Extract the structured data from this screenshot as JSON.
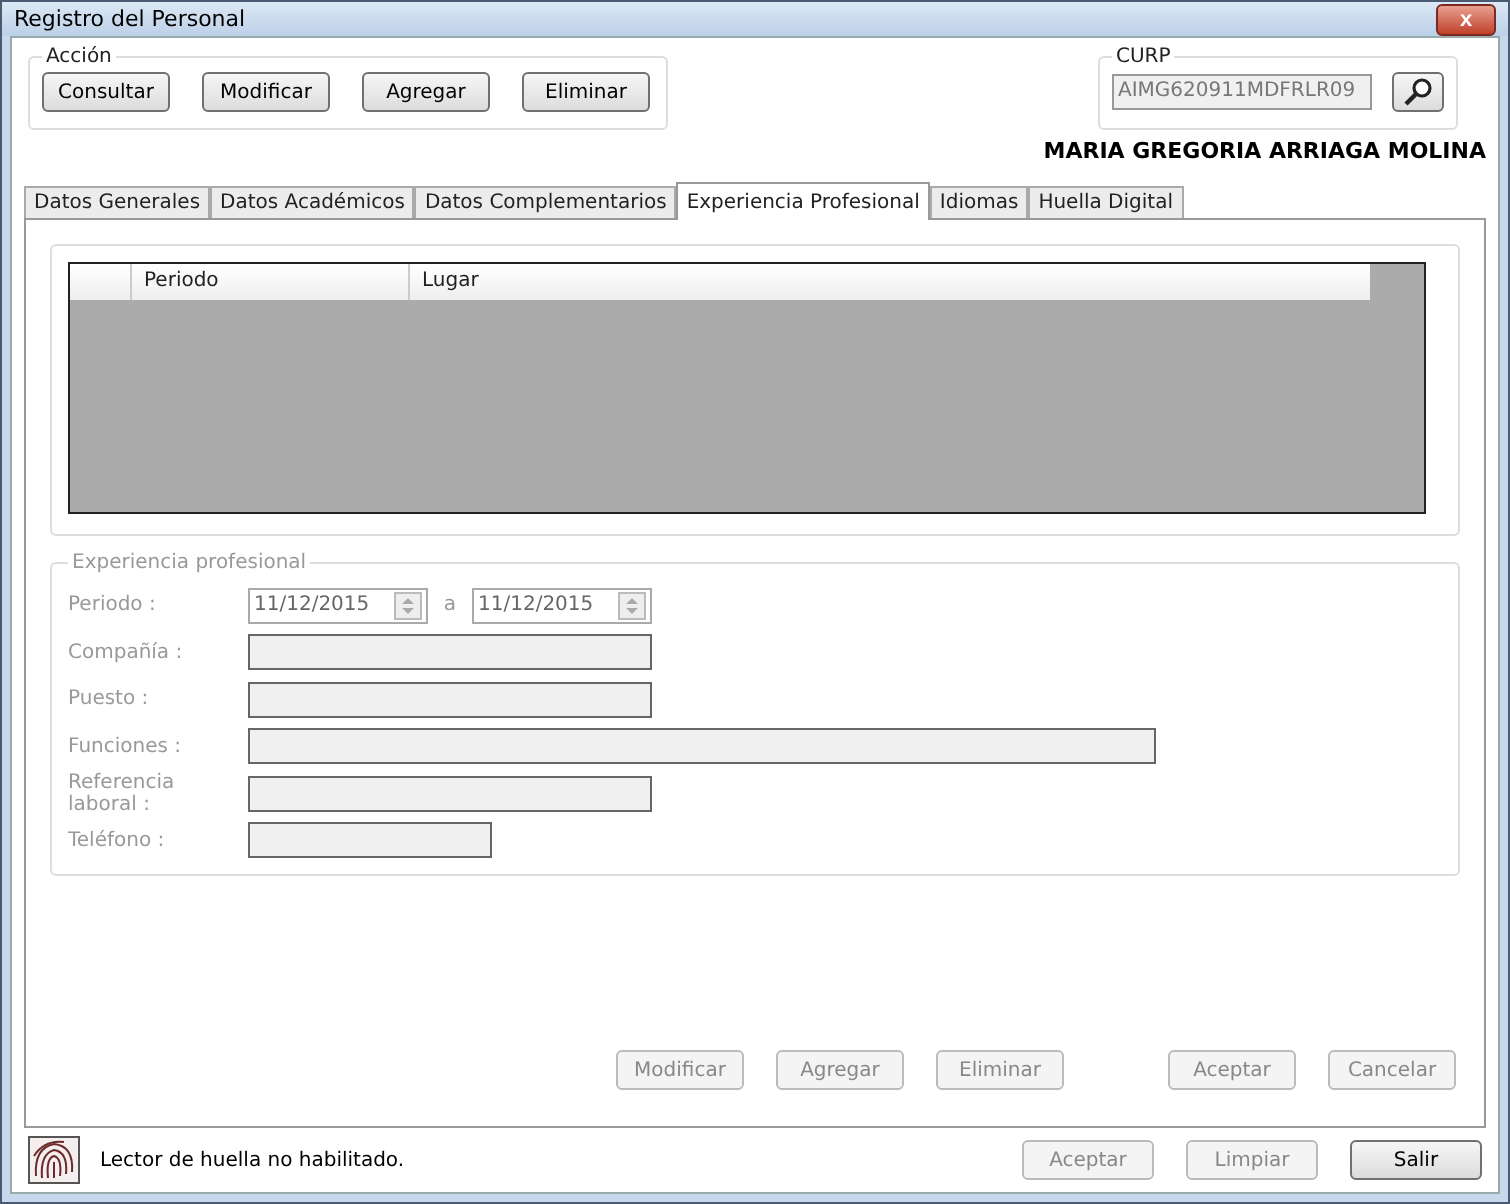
{
  "window": {
    "title": "Registro del Personal",
    "close": "x"
  },
  "action_group": {
    "title": "Acción",
    "buttons": [
      {
        "label": "Consultar",
        "disabled": false
      },
      {
        "label": "Modificar",
        "disabled": false
      },
      {
        "label": "Agregar",
        "disabled": false
      },
      {
        "label": "Eliminar",
        "disabled": false
      }
    ]
  },
  "curp_group": {
    "title": "CURP",
    "value": "AIMG620911MDFRLR09"
  },
  "person_name": "MARIA GREGORIA ARRIAGA MOLINA",
  "tabs": [
    {
      "label": "Datos Generales",
      "selected": false
    },
    {
      "label": "Datos Académicos",
      "selected": false
    },
    {
      "label": "Datos Complementarios",
      "selected": false
    },
    {
      "label": "Experiencia Profesional",
      "selected": true
    },
    {
      "label": "Idiomas",
      "selected": false
    },
    {
      "label": "Huella Digital",
      "selected": false
    }
  ],
  "table": {
    "columns": [
      "Periodo",
      "Lugar"
    ]
  },
  "form": {
    "title": "Experiencia profesional",
    "disabled": true,
    "period": {
      "label": "Periodo :",
      "from": "11/12/2015",
      "separator": "a",
      "to": "11/12/2015"
    },
    "fields": [
      {
        "label": "Compañía :"
      },
      {
        "label": "Puesto :"
      },
      {
        "label": "Funciones :"
      },
      {
        "label": "Referencia laboral :"
      },
      {
        "label": "Teléfono :"
      }
    ]
  },
  "form_buttons": [
    {
      "label": "Modificar",
      "disabled": true
    },
    {
      "label": "Agregar",
      "disabled": true
    },
    {
      "label": "Eliminar",
      "disabled": true
    },
    {
      "label": "Aceptar",
      "disabled": true
    },
    {
      "label": "Cancelar",
      "disabled": true
    }
  ],
  "status_bar": {
    "message": "Lector de huella no habilitado.",
    "buttons": [
      {
        "label": "Aceptar",
        "disabled": true
      },
      {
        "label": "Limpiar",
        "disabled": true
      },
      {
        "label": "Salir",
        "disabled": false
      }
    ]
  }
}
